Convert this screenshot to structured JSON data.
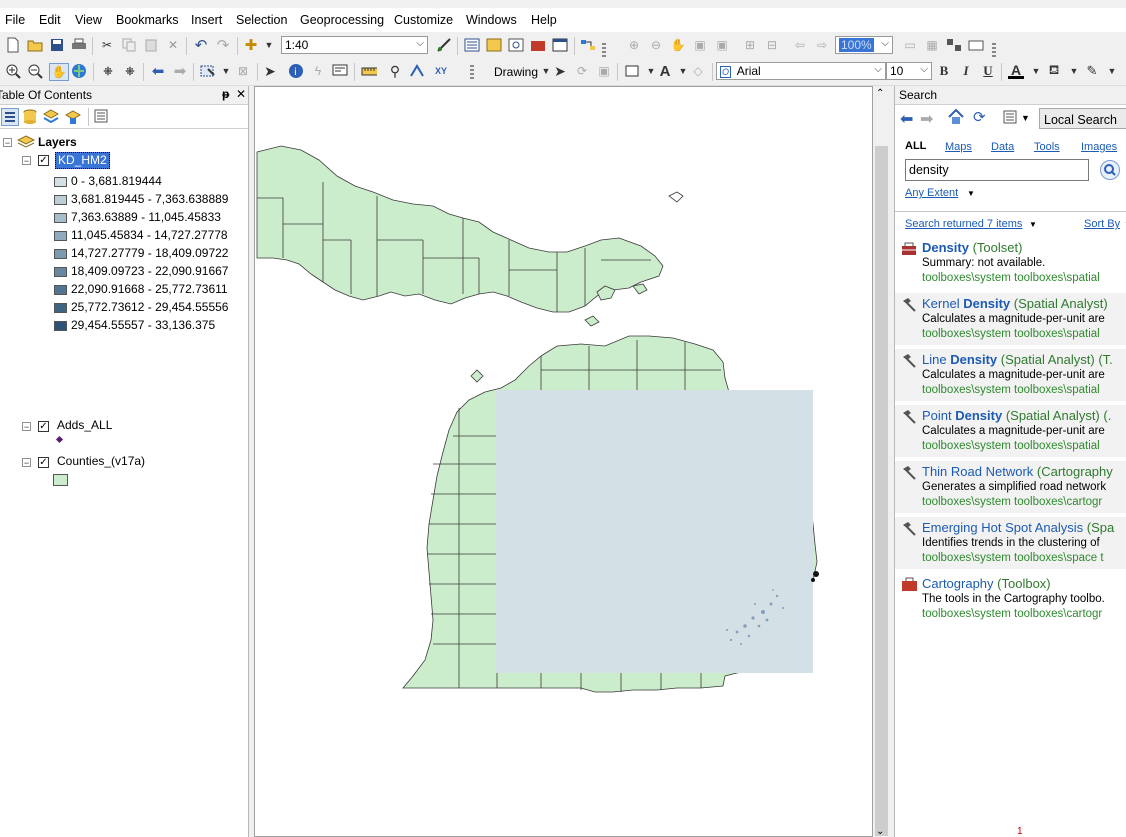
{
  "menu": [
    "File",
    "Edit",
    "View",
    "Bookmarks",
    "Insert",
    "Selection",
    "Geoprocessing",
    "Customize",
    "Windows",
    "Help"
  ],
  "toolbar": {
    "scale": "1:40",
    "zoom_percent": "100%",
    "drawing_label": "Drawing",
    "font": "Arial",
    "font_size": "10",
    "bold": "B",
    "italic": "I",
    "underline": "U",
    "text_tool": "A",
    "font_color": "A"
  },
  "toc": {
    "title": "Table Of Contents",
    "pin": "p",
    "close": "✕",
    "layers_label": "Layers",
    "layer1": {
      "name": "KD_HM2",
      "classes": [
        {
          "label": "0 - 3,681.819444",
          "color": "#d3e1e7"
        },
        {
          "label": "3,681.819445 - 7,363.638889",
          "color": "#bccfd9"
        },
        {
          "label": "7,363.63889 - 11,045.45833",
          "color": "#a6bdcb"
        },
        {
          "label": "11,045.45834 - 14,727.27778",
          "color": "#90abbd"
        },
        {
          "label": "14,727.27779 - 18,409.09722",
          "color": "#7b99af"
        },
        {
          "label": "18,409.09723 - 22,090.91667",
          "color": "#6687a1"
        },
        {
          "label": "22,090.91668 - 25,772.73611",
          "color": "#527593"
        },
        {
          "label": "25,772.73612 - 29,454.55556",
          "color": "#3f6385"
        },
        {
          "label": "29,454.55557 - 33,136.375",
          "color": "#2d5277"
        }
      ]
    },
    "layer2": {
      "name": "Adds_ALL"
    },
    "layer3": {
      "name": "Counties_(v17a)",
      "color": "#ccedcc"
    }
  },
  "search": {
    "title": "Search",
    "local_search": "Local Search",
    "tabs": [
      "ALL",
      "Maps",
      "Data",
      "Tools",
      "Images"
    ],
    "query": "density",
    "extent": "Any Extent",
    "returned": "Search returned 7 items",
    "sort": "Sort By",
    "results": [
      {
        "pre": "",
        "bold": "Density",
        "post": "",
        "type": " (Toolset)",
        "desc": "Summary: not available.",
        "path": "toolboxes\\system toolboxes\\spatial",
        "icon": "toolset"
      },
      {
        "pre": "Kernel ",
        "bold": "Density",
        "post": "",
        "type": " (Spatial Analyst)",
        "desc": "Calculates a magnitude-per-unit are",
        "path": "toolboxes\\system toolboxes\\spatial",
        "icon": "tool"
      },
      {
        "pre": "Line ",
        "bold": "Density",
        "post": "",
        "type": " (Spatial Analyst) (T.",
        "desc": "Calculates a magnitude-per-unit are",
        "path": "toolboxes\\system toolboxes\\spatial",
        "icon": "tool"
      },
      {
        "pre": "Point ",
        "bold": "Density",
        "post": "",
        "type": " (Spatial Analyst) (.",
        "desc": "Calculates a magnitude-per-unit are",
        "path": "toolboxes\\system toolboxes\\spatial",
        "icon": "tool"
      },
      {
        "pre": "Thin Road Network ",
        "bold": "",
        "post": "",
        "type": "(Cartography",
        "desc": "Generates a simplified road network",
        "path": "toolboxes\\system toolboxes\\cartogr",
        "icon": "tool"
      },
      {
        "pre": "Emerging Hot Spot Analysis ",
        "bold": "",
        "post": "",
        "type": "(Spa",
        "desc": "Identifies trends in the clustering of",
        "path": "toolboxes\\system toolboxes\\space t",
        "icon": "tool"
      },
      {
        "pre": "Cartography",
        "bold": "",
        "post": "",
        "type": " (Toolbox)",
        "desc": "The tools in the Cartography toolbo.",
        "path": "toolboxes\\system toolboxes\\cartogr",
        "icon": "toolbox"
      }
    ],
    "page_number": "1"
  },
  "colors": {
    "land": "#ccedcc",
    "raster": "#d3e1e7",
    "link": "#1c5bb5",
    "path": "#2f8a2f"
  }
}
